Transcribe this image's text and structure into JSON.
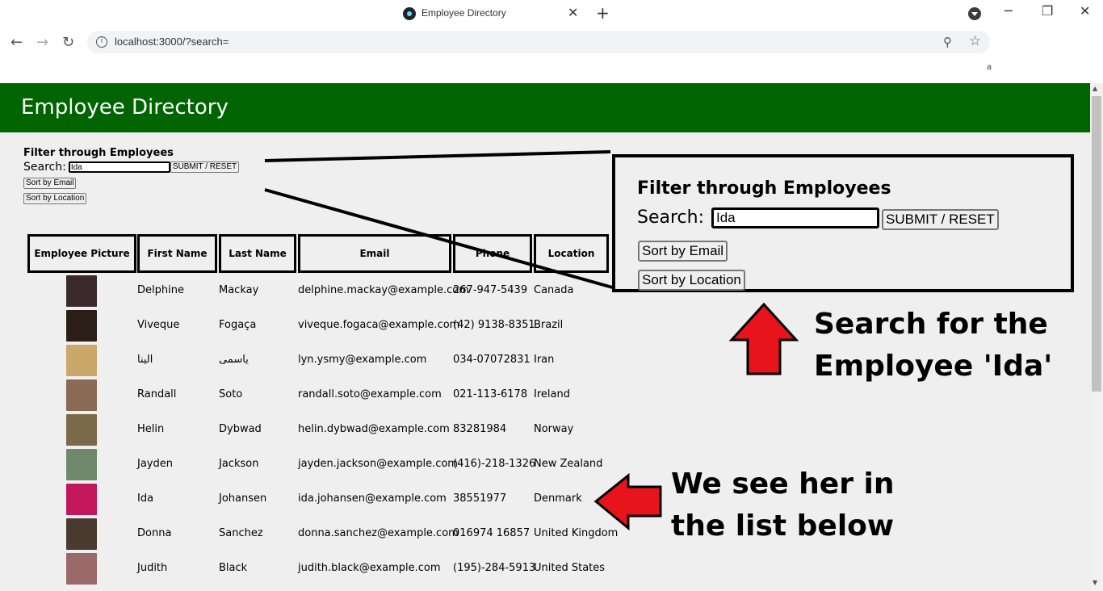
{
  "browser": {
    "tab_title": "Employee Directory",
    "tab_close": "✕",
    "new_tab": "+",
    "url": "localhost:3000/?search=",
    "bookmark_item": "a",
    "window_controls": [
      "─",
      "❐",
      "✕"
    ]
  },
  "header": {
    "title": "Employee Directory"
  },
  "filter": {
    "title": "Filter through Employees",
    "search_label": "Search:",
    "search_value": "Ida",
    "submit_label": "SUBMIT / RESET",
    "sort_email_label": "Sort by Email",
    "sort_location_label": "Sort by Location"
  },
  "table": {
    "columns": [
      "Employee Picture",
      "First Name",
      "Last Name",
      "Email",
      "Phone",
      "Location"
    ],
    "rows": [
      {
        "first": "Delphine",
        "last": "Mackay",
        "email": "delphine.mackay@example.com",
        "phone": "267-947-5439",
        "location": "Canada",
        "avatar_color": "#3a2a2e"
      },
      {
        "first": "Viveque",
        "last": "Fogaça",
        "email": "viveque.fogaca@example.com",
        "phone": "(42) 9138-8351",
        "location": "Brazil",
        "avatar_color": "#2b1d17"
      },
      {
        "first": "الینا",
        "last": "یاسمی",
        "email": "lyn.ysmy@example.com",
        "phone": "034-07072831",
        "location": "Iran",
        "avatar_color": "#c9a86a"
      },
      {
        "first": "Randall",
        "last": "Soto",
        "email": "randall.soto@example.com",
        "phone": "021-113-6178",
        "location": "Ireland",
        "avatar_color": "#8a6a55"
      },
      {
        "first": "Helin",
        "last": "Dybwad",
        "email": "helin.dybwad@example.com",
        "phone": "83281984",
        "location": "Norway",
        "avatar_color": "#7a6a4a"
      },
      {
        "first": "Jayden",
        "last": "Jackson",
        "email": "jayden.jackson@example.com",
        "phone": "(416)-218-1326",
        "location": "New Zealand",
        "avatar_color": "#6f8a6a"
      },
      {
        "first": "Ida",
        "last": "Johansen",
        "email": "ida.johansen@example.com",
        "phone": "38551977",
        "location": "Denmark",
        "avatar_color": "#c2185b"
      },
      {
        "first": "Donna",
        "last": "Sanchez",
        "email": "donna.sanchez@example.com",
        "phone": "016974 16857",
        "location": "United Kingdom",
        "avatar_color": "#4a3a30"
      },
      {
        "first": "Judith",
        "last": "Black",
        "email": "judith.black@example.com",
        "phone": "(195)-284-5913",
        "location": "United States",
        "avatar_color": "#9a6a6a"
      }
    ]
  },
  "annotation": {
    "zoom_title": "Filter through Employees",
    "zoom_search_label": "Search:",
    "zoom_search_value": "Ida",
    "zoom_submit_label": "SUBMIT / RESET",
    "zoom_sort_email_label": "Sort by Email",
    "zoom_sort_location_label": "Sort by Location",
    "callout_search_line1": "Search for the",
    "callout_search_line2": "Employee 'Ida'",
    "callout_list_line1": "We see her in",
    "callout_list_line2": "the list below",
    "arrow_color": "#e8141b"
  }
}
